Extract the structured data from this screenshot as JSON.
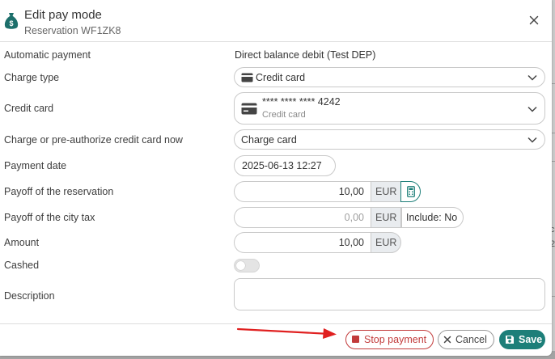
{
  "header": {
    "title": "Edit pay mode",
    "subtitle": "Reservation WF1ZK8"
  },
  "form": {
    "automatic_payment": {
      "label": "Automatic payment",
      "value": "Direct balance debit (Test DEP)"
    },
    "charge_type": {
      "label": "Charge type",
      "value": "Credit card"
    },
    "credit_card": {
      "label": "Credit card",
      "number": "**** **** **** 4242",
      "sub": "Credit card"
    },
    "charge_or_preauth": {
      "label": "Charge or pre-authorize credit card now",
      "value": "Charge card"
    },
    "payment_date": {
      "label": "Payment date",
      "value": "2025-06-13 12:27"
    },
    "payoff_reservation": {
      "label": "Payoff of the reservation",
      "value": "10,00",
      "currency": "EUR"
    },
    "payoff_city_tax": {
      "label": "Payoff of the city tax",
      "value": "0,00",
      "currency": "EUR",
      "include": "Include: No"
    },
    "amount": {
      "label": "Amount",
      "value": "10,00",
      "currency": "EUR"
    },
    "cashed": {
      "label": "Cashed",
      "on": false
    },
    "description": {
      "label": "Description",
      "value": ""
    }
  },
  "footer": {
    "stop_label": "Stop payment",
    "cancel_label": "Cancel",
    "save_label": "Save"
  },
  "colors": {
    "accent": "#1d7f79",
    "danger": "#c23b3b",
    "annotation_arrow": "#e02020"
  },
  "icons": {
    "header": "money-bag-icon",
    "close": "close-icon",
    "charge_type": "credit-card-icon",
    "calculator": "calculator-icon",
    "stop": "stop-square-icon",
    "cancel": "x-circle-icon",
    "save": "floppy-disk-icon"
  }
}
